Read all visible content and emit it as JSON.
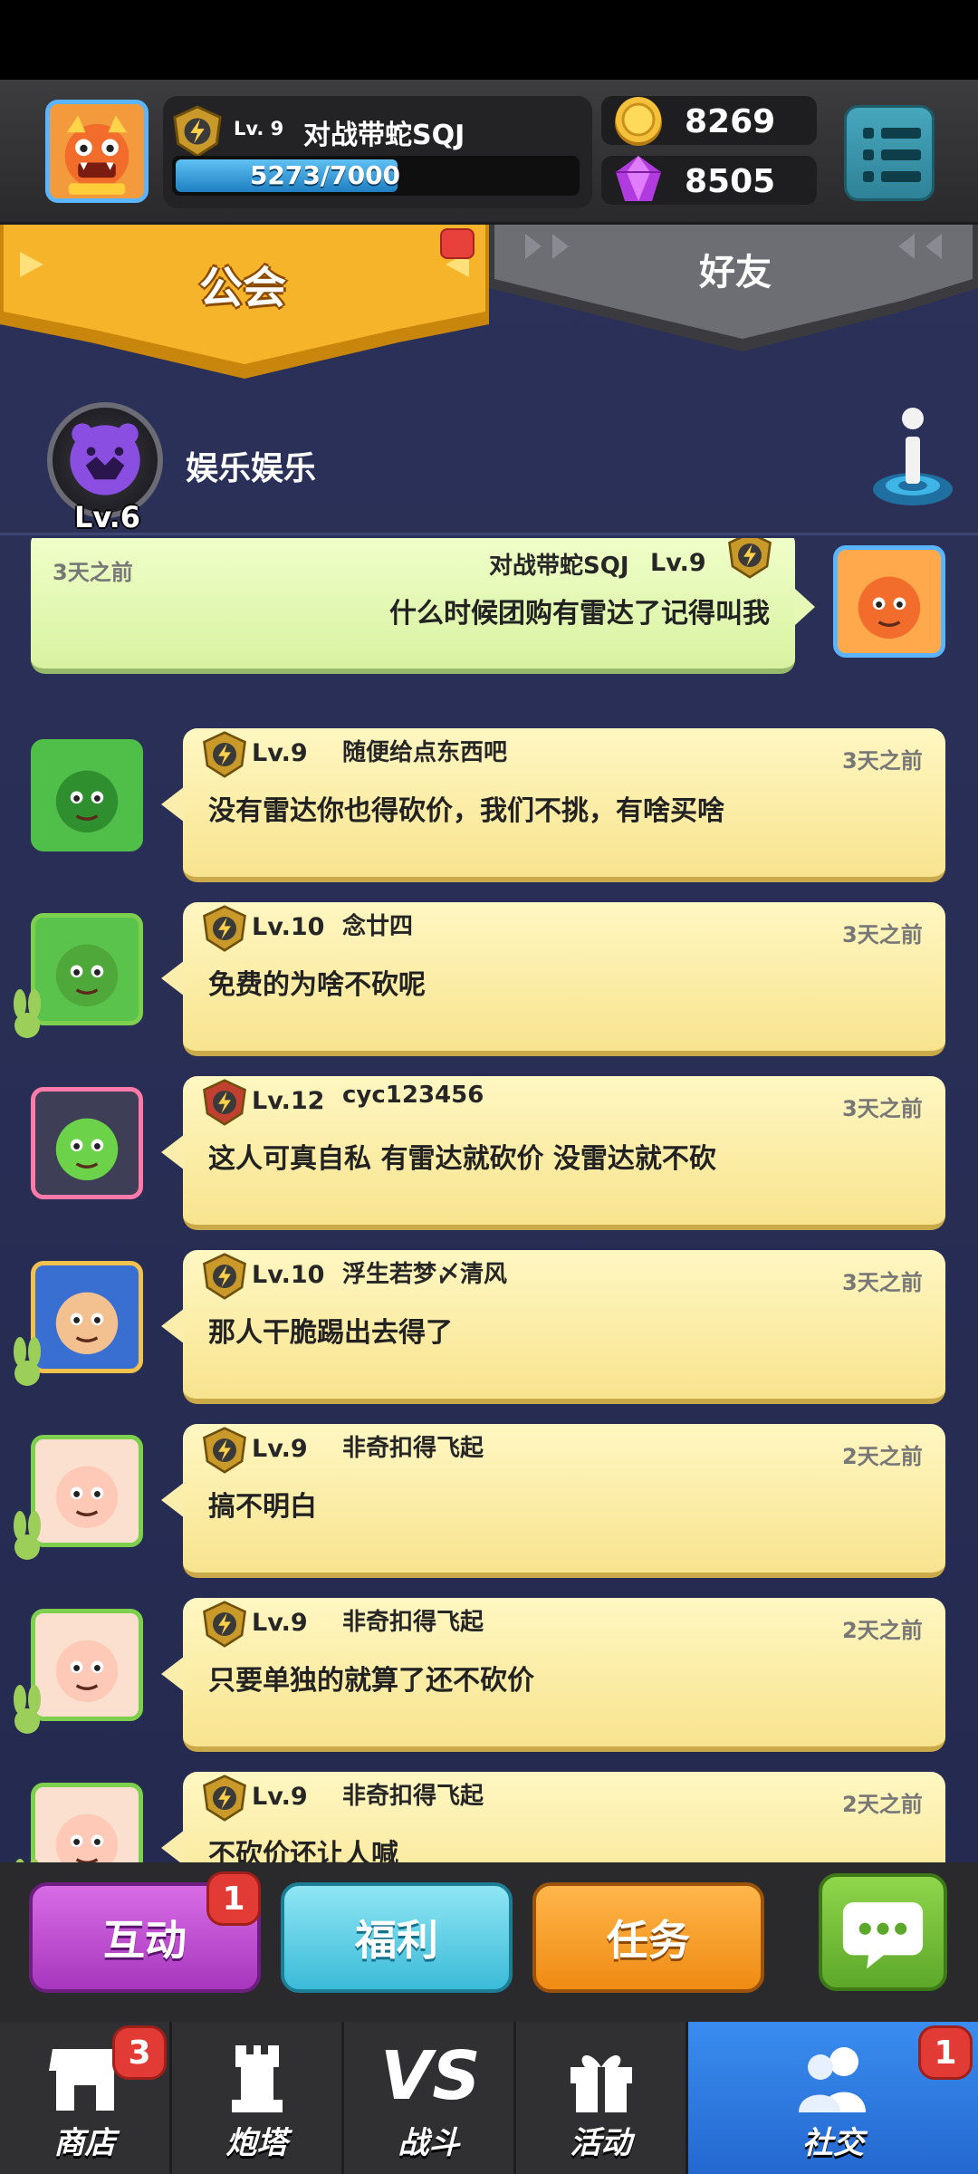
{
  "player": {
    "level": "Lv. 9",
    "name": "对战带蛇SQJ",
    "xp_text": "5273/7000",
    "xp_fraction": 0.753,
    "gold": "8269",
    "gems": "8505",
    "avatar_icon": "dragon-avatar-icon",
    "menu_icon": "list-menu-icon"
  },
  "tabs": {
    "guild": "公会",
    "friends": "好友",
    "active": "guild"
  },
  "guild": {
    "name": "娱乐娱乐",
    "level": "Lv.6",
    "info_icon": "info-icon"
  },
  "messages": [
    {
      "mine": true,
      "time": "3天之前",
      "user": "对战带蛇SQJ",
      "level": "Lv.9",
      "text": "什么时候团购有雷达了记得叫我"
    },
    {
      "mine": false,
      "time": "3天之前",
      "user": "随便给点东西吧",
      "level": "Lv.9",
      "text": "没有雷达你也得砍价，我们不挑，有啥买啥"
    },
    {
      "mine": false,
      "time": "3天之前",
      "user": "念廿四",
      "level": "Lv.10",
      "text": "免费的为啥不砍呢"
    },
    {
      "mine": false,
      "time": "3天之前",
      "user": "cyc123456",
      "level": "Lv.12",
      "text": "这人可真自私 有雷达就砍价 没雷达就不砍"
    },
    {
      "mine": false,
      "time": "3天之前",
      "user": "浮生若梦〆清风",
      "level": "Lv.10",
      "text": "那人干脆踢出去得了"
    },
    {
      "mine": false,
      "time": "2天之前",
      "user": "非奇扣得飞起",
      "level": "Lv.9",
      "text": "搞不明白"
    },
    {
      "mine": false,
      "time": "2天之前",
      "user": "非奇扣得飞起",
      "level": "Lv.9",
      "text": "只要单独的就算了还不砍价"
    },
    {
      "mine": false,
      "time": "2天之前",
      "user": "非奇扣得飞起",
      "level": "Lv.9",
      "text": "不砍价还让人喊"
    }
  ],
  "actions": {
    "interact": "互动",
    "interact_badge": "1",
    "welfare": "福利",
    "tasks": "任务",
    "chat_icon": "chat-bubble-icon"
  },
  "nav": {
    "shop": "商店",
    "shop_badge": "3",
    "tower": "炮塔",
    "battle": "战斗",
    "battle_icon_text": "VS",
    "events": "活动",
    "social": "社交",
    "social_badge": "1"
  },
  "colors": {
    "guild_tab": "#f6b42a",
    "friends_tab": "#6a6a70",
    "social_active": "#2f7fe0",
    "interact_btn": "#c14fd3",
    "welfare_btn": "#4fc6df",
    "tasks_btn": "#f39d23"
  }
}
